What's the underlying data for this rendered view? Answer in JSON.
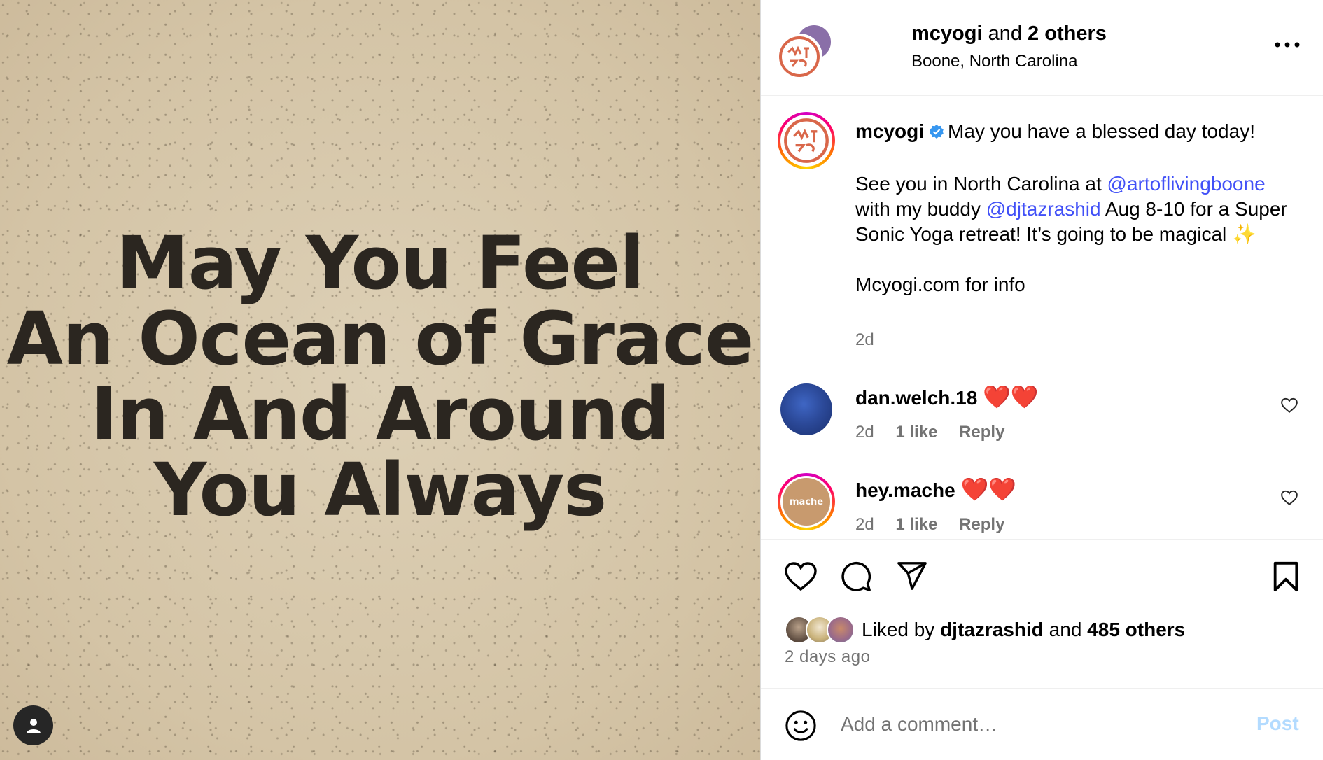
{
  "media": {
    "quote_lines": [
      "May You Feel",
      "An Ocean of Grace",
      "In And Around",
      "You Always"
    ],
    "tag_icon": "person-icon"
  },
  "header": {
    "username": "mcyogi",
    "and_text": "and",
    "others": "2 others",
    "location": "Boone, North Carolina",
    "more_icon": "more-horizontal-icon"
  },
  "caption": {
    "username": "mcyogi",
    "line1": "May you have a blessed day today!",
    "p2_a": "See you in North Carolina at ",
    "mention1": "@artoflivingboone",
    "p2_b": " with my buddy ",
    "mention2": "@djtazrashid",
    "p2_c": " Aug 8-10 for a Super Sonic Yoga retreat! It’s going to be magical ",
    "sparkles": "✨",
    "p3": "Mcyogi.com for info",
    "time": "2d"
  },
  "comments": [
    {
      "username": "dan.welch.18",
      "text": "❤️❤️",
      "time": "2d",
      "likes": "1 like",
      "reply": "Reply",
      "avatar_color": "#2c4a9a"
    },
    {
      "username": "hey.mache",
      "text": "❤️❤️",
      "time": "2d",
      "likes": "1 like",
      "reply": "Reply",
      "avatar_label": "mache",
      "avatar_color": "#c89a6e"
    }
  ],
  "actions": {
    "liked_by_prefix": "Liked by",
    "liked_by_user": "djtazrashid",
    "liked_by_and": "and",
    "liked_by_others": "485 others",
    "time_ago": "2 days ago"
  },
  "add_comment": {
    "placeholder": "Add a comment…",
    "post_label": "Post"
  },
  "colors": {
    "link": "#4150f7",
    "muted": "#737373",
    "post_disabled": "#b3dbff"
  }
}
